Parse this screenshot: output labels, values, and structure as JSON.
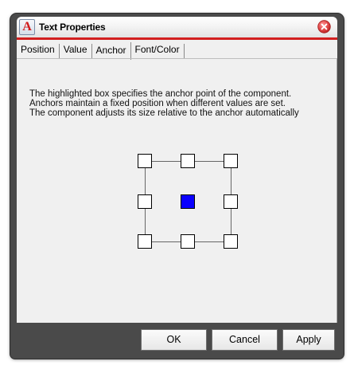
{
  "window": {
    "title": "Text Properties",
    "app_icon_letter": "A"
  },
  "tabs": [
    {
      "label": "Position",
      "active": false
    },
    {
      "label": "Value",
      "active": false
    },
    {
      "label": "Anchor",
      "active": true
    },
    {
      "label": "Font/Color",
      "active": false
    }
  ],
  "anchor_tab": {
    "description_lines": [
      "The highlighted box specifies the anchor point of the component.",
      "Anchors maintain a fixed position when different values are set.",
      "The component adjusts its size relative to the anchor automatically"
    ],
    "selected_anchor": "center",
    "anchors": [
      "top-left",
      "top-center",
      "top-right",
      "middle-left",
      "center",
      "middle-right",
      "bottom-left",
      "bottom-center",
      "bottom-right"
    ]
  },
  "buttons": {
    "ok": "OK",
    "cancel": "Cancel",
    "apply": "Apply"
  },
  "colors": {
    "title_accent": "#d21f1f",
    "selected_anchor": "#0a00ff",
    "close_button": "#e04545"
  }
}
